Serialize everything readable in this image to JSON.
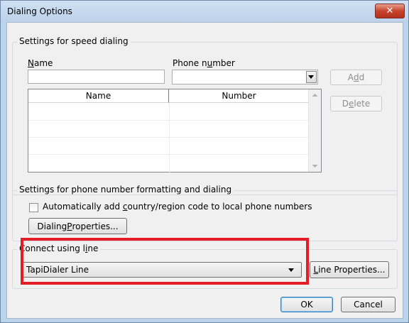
{
  "window": {
    "title": "Dialing Options",
    "close_glyph": "✕"
  },
  "speed_dialing": {
    "legend": "Settings for speed dialing",
    "name_label": {
      "before": "",
      "accel": "N",
      "after": "ame"
    },
    "phone_label": {
      "before": "Phone n",
      "accel": "u",
      "after": "mber"
    },
    "name_value": "",
    "phone_value": "",
    "columns": [
      "Name",
      "Number"
    ],
    "rows": [],
    "add_button": {
      "before": "A",
      "accel": "d",
      "after": "d"
    },
    "delete_button": {
      "before": "D",
      "accel": "e",
      "after": "lete"
    }
  },
  "formatting": {
    "legend": "Settings for phone number formatting and dialing",
    "checkbox_label": {
      "before": "Automatically add ",
      "accel": "c",
      "after": "ountry/region code to local phone numbers"
    },
    "checked": false,
    "dialing_properties_button": {
      "before": "Dialing ",
      "accel": "P",
      "after": "roperties..."
    }
  },
  "connect": {
    "legend": {
      "before": "Connect using l",
      "accel": "i",
      "after": "ne"
    },
    "selected_line": "TapiDialer Line",
    "line_properties_button": {
      "before": "",
      "accel": "L",
      "after": "ine Properties..."
    }
  },
  "footer": {
    "ok_label": "OK",
    "cancel_label": "Cancel"
  },
  "colors": {
    "highlight": "#e41c24",
    "title_bar": "#bcd3ec",
    "close_button": "#c7432c"
  }
}
